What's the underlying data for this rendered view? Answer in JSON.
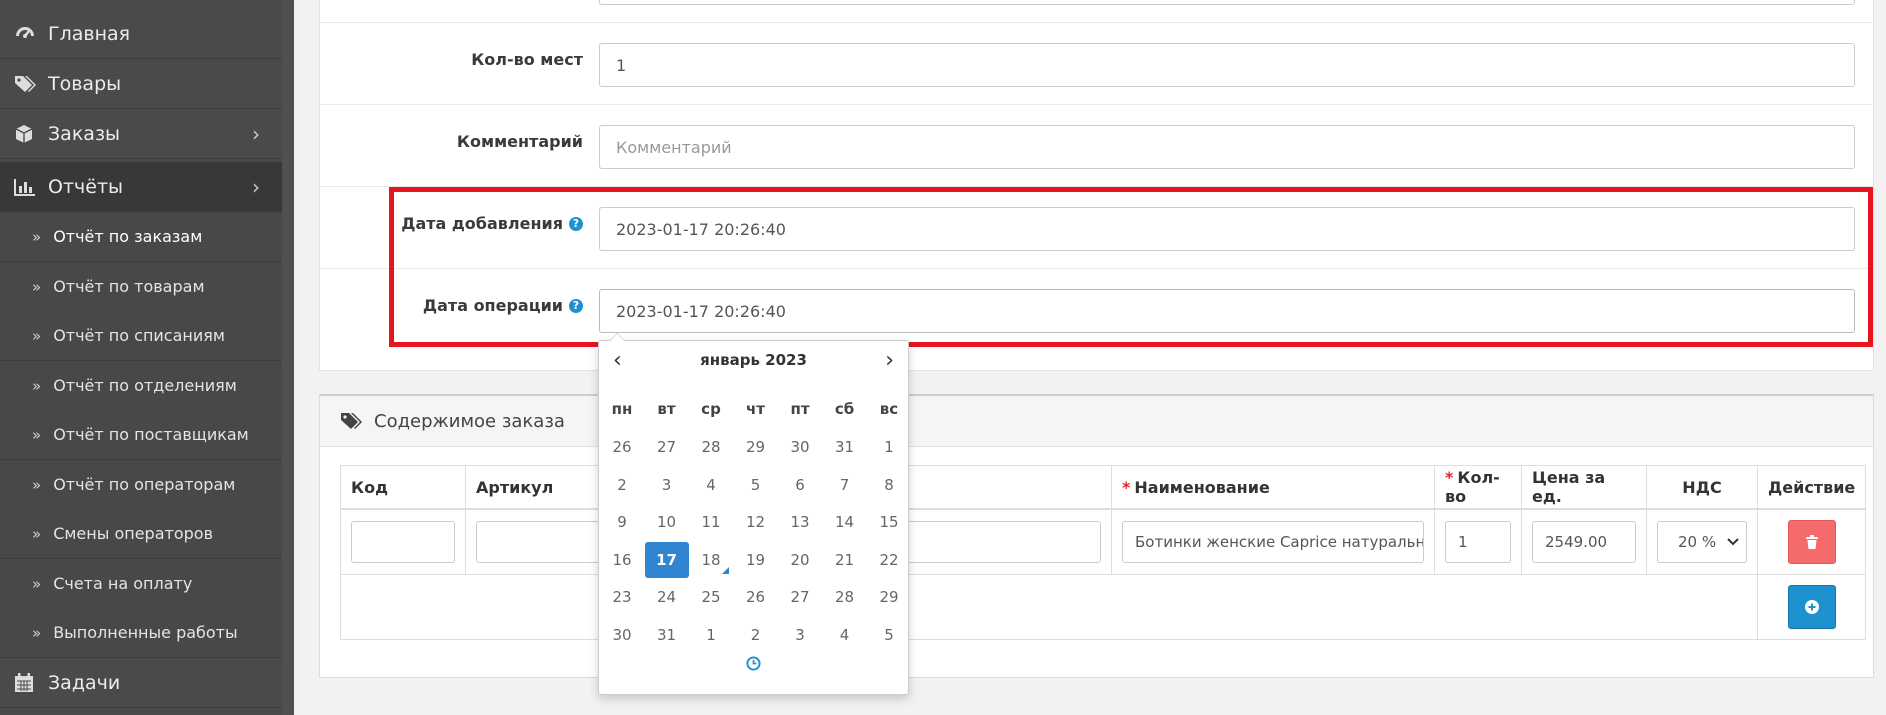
{
  "sidebar": {
    "items": [
      {
        "label": "Главная",
        "icon": "dashboard-icon",
        "has_chevron": false
      },
      {
        "label": "Товары",
        "icon": "tags-icon",
        "has_chevron": false
      },
      {
        "label": "Заказы",
        "icon": "cube-icon",
        "has_chevron": true
      },
      {
        "label": "Отчёты",
        "icon": "bar-chart-icon",
        "has_chevron": true,
        "active": true
      }
    ],
    "chevron": "›",
    "sub_bullet": "»",
    "subitems": [
      {
        "label": "Отчёт по заказам",
        "active": true
      },
      {
        "label": "Отчёт по товарам"
      },
      {
        "label": "Отчёт по списаниям"
      },
      {
        "label": "Отчёт по отделениям"
      },
      {
        "label": "Отчёт по поставщикам"
      },
      {
        "label": "Отчёт по операторам"
      },
      {
        "label": "Смены операторов"
      },
      {
        "label": "Счета на оплату"
      },
      {
        "label": "Выполненные работы"
      }
    ],
    "bottom_item": {
      "label": "Задачи",
      "icon": "calendar-icon"
    }
  },
  "form": {
    "places": {
      "label": "Кол-во мест",
      "value": "1"
    },
    "comment": {
      "label": "Комментарий",
      "placeholder": "Комментарий"
    },
    "date_added": {
      "label": "Дата добавления",
      "value": "2023-01-17 20:26:40"
    },
    "date_operation": {
      "label": "Дата операции",
      "value": "2023-01-17 20:26:40"
    },
    "help_glyph": "?"
  },
  "order": {
    "title": "Содержимое заказа",
    "required_mark": "*",
    "columns": {
      "code": "Код",
      "article": "Артикул",
      "name": "Наименование",
      "qty": "Кол-во",
      "price": "Цена за ед.",
      "vat": "НДС",
      "action": "Действие"
    },
    "row": {
      "code": "",
      "article": "",
      "name": "Ботинки женские Caprice натуральн",
      "qty": "1",
      "price": "2549.00",
      "vat": "20 %"
    }
  },
  "datepicker": {
    "month_label": "январь 2023",
    "prev": "‹",
    "next": "›",
    "weekdays": [
      "пн",
      "вт",
      "ср",
      "чт",
      "пт",
      "сб",
      "вс"
    ],
    "weeks": [
      [
        "26",
        "27",
        "28",
        "29",
        "30",
        "31",
        "1"
      ],
      [
        "2",
        "3",
        "4",
        "5",
        "6",
        "7",
        "8"
      ],
      [
        "9",
        "10",
        "11",
        "12",
        "13",
        "14",
        "15"
      ],
      [
        "16",
        "17",
        "18",
        "19",
        "20",
        "21",
        "22"
      ],
      [
        "23",
        "24",
        "25",
        "26",
        "27",
        "28",
        "29"
      ],
      [
        "30",
        "31",
        "1",
        "2",
        "3",
        "4",
        "5"
      ]
    ],
    "selected_day": "17",
    "today_day": "18"
  },
  "colors": {
    "highlight": "#e8151f",
    "primary": "#1e91cf",
    "danger": "#f56b6b",
    "sidebar": "#4a4a4a"
  }
}
